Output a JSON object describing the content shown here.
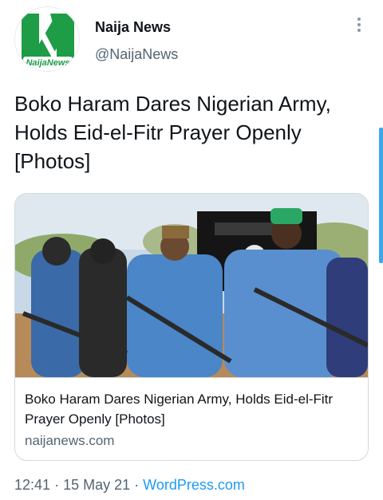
{
  "account": {
    "display_name": "Naija News",
    "handle": "@NaijaNews",
    "avatar_text": "NaijaNews"
  },
  "tweet": {
    "text": "Boko Haram Dares Nigerian Army, Holds Eid-el-Fitr Prayer Openly [Photos]"
  },
  "card": {
    "title": "Boko Haram Dares Nigerian Army, Holds Eid-el-Fitr Prayer Openly [Photos]",
    "domain": "naijanews.com",
    "image_alt": "Group photo"
  },
  "meta": {
    "time": "12:41",
    "separator": "·",
    "date": "15 May 21",
    "source": "WordPress.com"
  },
  "colors": {
    "accent": "#1d9bf0",
    "logo_green": "#1e9c46"
  }
}
